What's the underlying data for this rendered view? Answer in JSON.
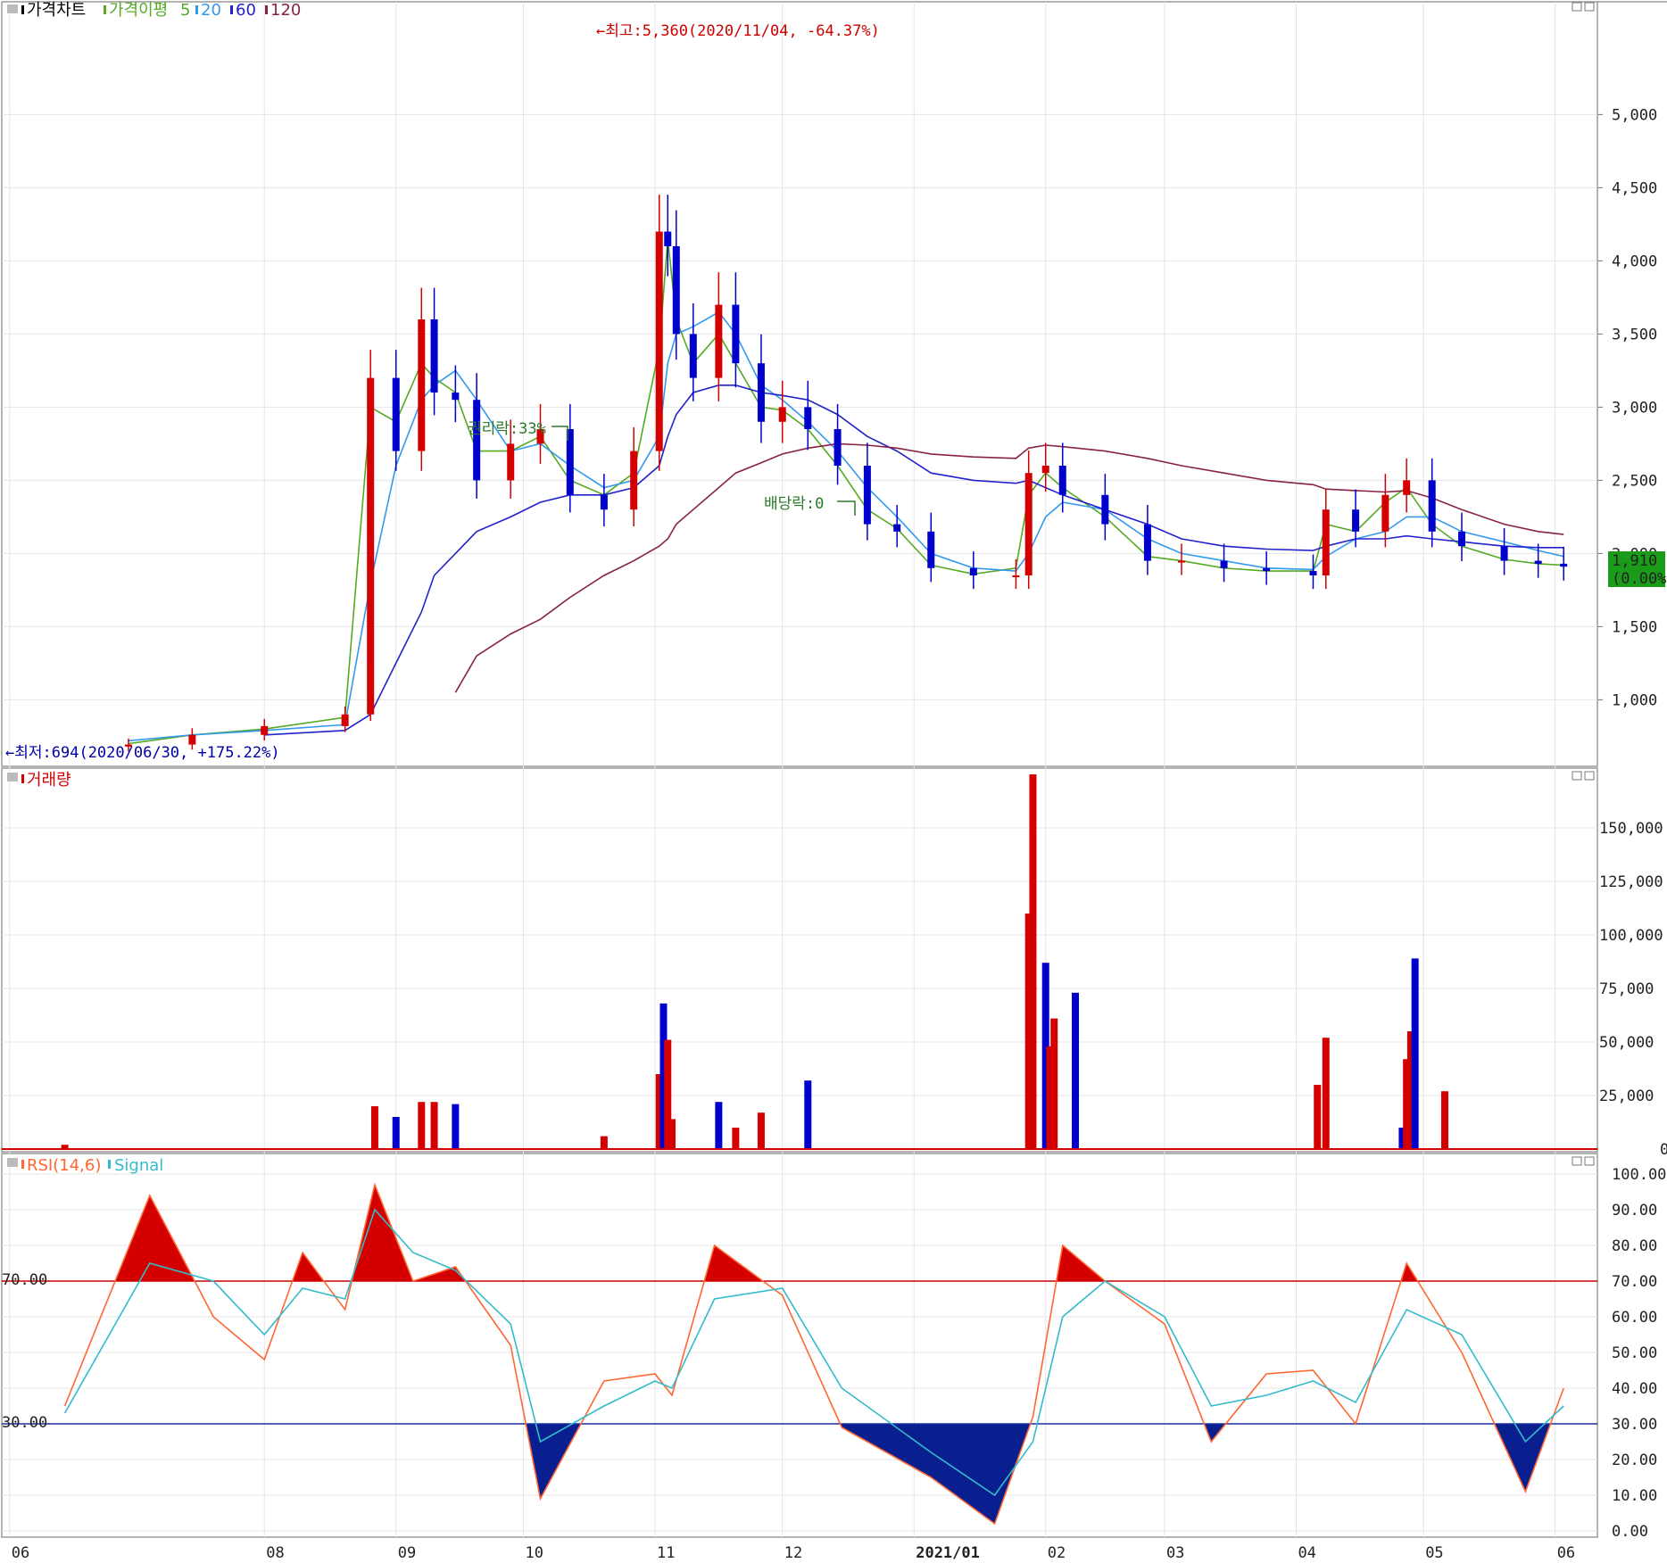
{
  "price_panel": {
    "legend": {
      "title": "가격차트",
      "ma_title": "가격이평",
      "ma5": "5",
      "ma20": "20",
      "ma60": "60",
      "ma120": "120"
    },
    "high_annotation": "←최고:5,360(2020/11/04, -64.37%)",
    "low_annotation": "←최저:694(2020/06/30, +175.22%)",
    "event_1": "권리락:33%",
    "event_2": "배당락:0",
    "last_price": "1,910",
    "last_change": "(0.00%)",
    "y_ticks": [
      "5,000",
      "4,500",
      "4,000",
      "3,500",
      "3,000",
      "2,500",
      "2,000",
      "1,500",
      "1,000"
    ]
  },
  "volume_panel": {
    "legend": "거래량",
    "y_ticks": [
      "150,000",
      "125,000",
      "100,000",
      "75,000",
      "50,000",
      "25,000",
      "0"
    ]
  },
  "rsi_panel": {
    "legend_rsi": "RSI(14,6)",
    "legend_signal": "Signal",
    "level_high": "70.00",
    "level_low": "30.00",
    "y_ticks": [
      "100.00",
      "90.00",
      "80.00",
      "70.00",
      "60.00",
      "50.00",
      "40.00",
      "30.00",
      "20.00",
      "10.00",
      "0.00"
    ]
  },
  "x_labels": [
    "06",
    "08",
    "09",
    "10",
    "11",
    "12",
    "2021/01",
    "02",
    "03",
    "04",
    "05",
    "06"
  ],
  "colors": {
    "up": "#d40000",
    "down": "#0000cc",
    "ma5": "#55aa22",
    "ma20": "#3399ee",
    "ma60": "#2222cc",
    "ma120": "#882244",
    "rsi": "#ff6633",
    "signal": "#33bbcc",
    "last_price_bg": "#1a9c1a"
  },
  "chart_data": [
    {
      "type": "candlestick",
      "title": "가격차트",
      "ylim": [
        600,
        5600
      ],
      "dates": [
        "2020/06/30",
        "2020/07/15",
        "2020/08/01",
        "2020/08/20",
        "2020/08/26",
        "2020/09/01",
        "2020/09/07",
        "2020/09/10",
        "2020/09/15",
        "2020/09/20",
        "2020/09/28",
        "2020/10/05",
        "2020/10/12",
        "2020/10/20",
        "2020/10/27",
        "2020/11/02",
        "2020/11/04",
        "2020/11/06",
        "2020/11/10",
        "2020/11/16",
        "2020/11/20",
        "2020/11/26",
        "2020/12/01",
        "2020/12/07",
        "2020/12/14",
        "2020/12/21",
        "2020/12/28",
        "2021/01/05",
        "2021/01/15",
        "2021/01/25",
        "2021/01/28",
        "2021/02/01",
        "2021/02/05",
        "2021/02/15",
        "2021/02/25",
        "2021/03/05",
        "2021/03/15",
        "2021/03/25",
        "2021/04/05",
        "2021/04/08",
        "2021/04/15",
        "2021/04/22",
        "2021/04/27",
        "2021/05/03",
        "2021/05/10",
        "2021/05/20",
        "2021/05/28",
        "2021/06/03"
      ],
      "close": [
        694,
        760,
        820,
        900,
        3200,
        2700,
        3600,
        3100,
        3050,
        2500,
        2750,
        2850,
        2400,
        2300,
        2700,
        4200,
        4100,
        3500,
        3200,
        3700,
        3300,
        2900,
        3000,
        2850,
        2600,
        2200,
        2150,
        1900,
        1850,
        1850,
        2550,
        2600,
        2400,
        2200,
        1950,
        1950,
        1900,
        1880,
        1850,
        2300,
        2150,
        2400,
        2500,
        2150,
        2050,
        1950,
        1930,
        1910
      ],
      "series": [
        {
          "name": "5",
          "values": [
            700,
            760,
            800,
            880,
            3000,
            2900,
            3300,
            3200,
            3100,
            2700,
            2700,
            2800,
            2500,
            2400,
            2550,
            3400,
            4150,
            3600,
            3300,
            3500,
            3300,
            3000,
            2980,
            2850,
            2600,
            2300,
            2170,
            1920,
            1860,
            1900,
            2400,
            2550,
            2450,
            2250,
            1980,
            1950,
            1900,
            1880,
            1880,
            2200,
            2150,
            2350,
            2450,
            2200,
            2050,
            1960,
            1930,
            1920
          ]
        },
        {
          "name": "20",
          "values": [
            720,
            760,
            790,
            830,
            1800,
            2600,
            3050,
            3150,
            3250,
            3050,
            2700,
            2750,
            2600,
            2450,
            2500,
            2800,
            3300,
            3500,
            3550,
            3650,
            3500,
            3150,
            3050,
            2900,
            2700,
            2450,
            2250,
            2000,
            1900,
            1880,
            2000,
            2250,
            2350,
            2300,
            2100,
            2000,
            1950,
            1900,
            1890,
            1980,
            2100,
            2150,
            2250,
            2250,
            2150,
            2080,
            2020,
            1980
          ]
        },
        {
          "name": "60",
          "values": [
            null,
            null,
            760,
            790,
            900,
            1250,
            1600,
            1850,
            2000,
            2150,
            2250,
            2350,
            2400,
            2400,
            2450,
            2600,
            2800,
            2950,
            3100,
            3150,
            3150,
            3100,
            3080,
            3050,
            2950,
            2800,
            2700,
            2550,
            2500,
            2480,
            2500,
            2450,
            2400,
            2300,
            2200,
            2100,
            2050,
            2030,
            2020,
            2050,
            2100,
            2100,
            2120,
            2100,
            2080,
            2050,
            2040,
            2040
          ]
        },
        {
          "name": "120",
          "values": [
            null,
            null,
            null,
            null,
            null,
            null,
            null,
            null,
            1050,
            1300,
            1450,
            1550,
            1700,
            1850,
            1950,
            2050,
            2100,
            2200,
            2300,
            2450,
            2550,
            2620,
            2680,
            2720,
            2750,
            2740,
            2720,
            2680,
            2660,
            2650,
            2720,
            2740,
            2730,
            2700,
            2650,
            2600,
            2550,
            2500,
            2470,
            2440,
            2430,
            2420,
            2430,
            2380,
            2300,
            2200,
            2150,
            2130
          ]
        }
      ]
    },
    {
      "type": "bar",
      "title": "거래량",
      "ylim": [
        0,
        170000
      ],
      "categories": [
        "2020/06",
        "2020/08/27",
        "2020/09/01",
        "2020/09/07",
        "2020/09/10",
        "2020/09/15",
        "2020/10/20",
        "2020/11/02",
        "2020/11/03",
        "2020/11/04",
        "2020/11/05",
        "2020/11/16",
        "2020/11/20",
        "2020/11/26",
        "2020/12/07",
        "2021/01/28",
        "2021/01/29",
        "2021/02/01",
        "2021/02/02",
        "2021/02/03",
        "2021/02/08",
        "2021/04/06",
        "2021/04/08",
        "2021/04/26",
        "2021/04/27",
        "2021/04/28",
        "2021/04/29",
        "2021/05/06"
      ],
      "values": [
        2000,
        20000,
        15000,
        22000,
        22000,
        21000,
        6000,
        35000,
        68000,
        51000,
        14000,
        22000,
        10000,
        17000,
        32000,
        110000,
        175000,
        87000,
        48000,
        61000,
        73000,
        30000,
        52000,
        10000,
        42000,
        55000,
        89000,
        27000
      ]
    },
    {
      "type": "line",
      "title": "RSI(14,6)",
      "ylim": [
        0,
        100
      ],
      "x": [
        "2020/06",
        "2020/07/05",
        "2020/07/20",
        "2020/08/01",
        "2020/08/10",
        "2020/08/20",
        "2020/08/27",
        "2020/09/05",
        "2020/09/15",
        "2020/09/28",
        "2020/10/05",
        "2020/10/20",
        "2020/11/01",
        "2020/11/05",
        "2020/11/15",
        "2020/12/01",
        "2020/12/15",
        "2021/01/05",
        "2021/01/20",
        "2021/01/29",
        "2021/02/05",
        "2021/02/15",
        "2021/03/01",
        "2021/03/12",
        "2021/03/25",
        "2021/04/05",
        "2021/04/15",
        "2021/04/27",
        "2021/05/10",
        "2021/05/25",
        "2021/06/03"
      ],
      "series": [
        {
          "name": "RSI",
          "values": [
            35,
            94,
            60,
            48,
            78,
            62,
            97,
            70,
            74,
            52,
            9,
            42,
            44,
            38,
            80,
            66,
            29,
            15,
            2,
            32,
            80,
            70,
            58,
            25,
            44,
            45,
            30,
            75,
            50,
            11,
            40
          ]
        },
        {
          "name": "Signal",
          "values": [
            33,
            75,
            70,
            55,
            68,
            65,
            90,
            78,
            73,
            58,
            25,
            35,
            42,
            40,
            65,
            68,
            40,
            22,
            10,
            25,
            60,
            70,
            60,
            35,
            38,
            42,
            36,
            62,
            55,
            25,
            35
          ]
        }
      ],
      "levels": [
        70,
        30
      ]
    }
  ]
}
